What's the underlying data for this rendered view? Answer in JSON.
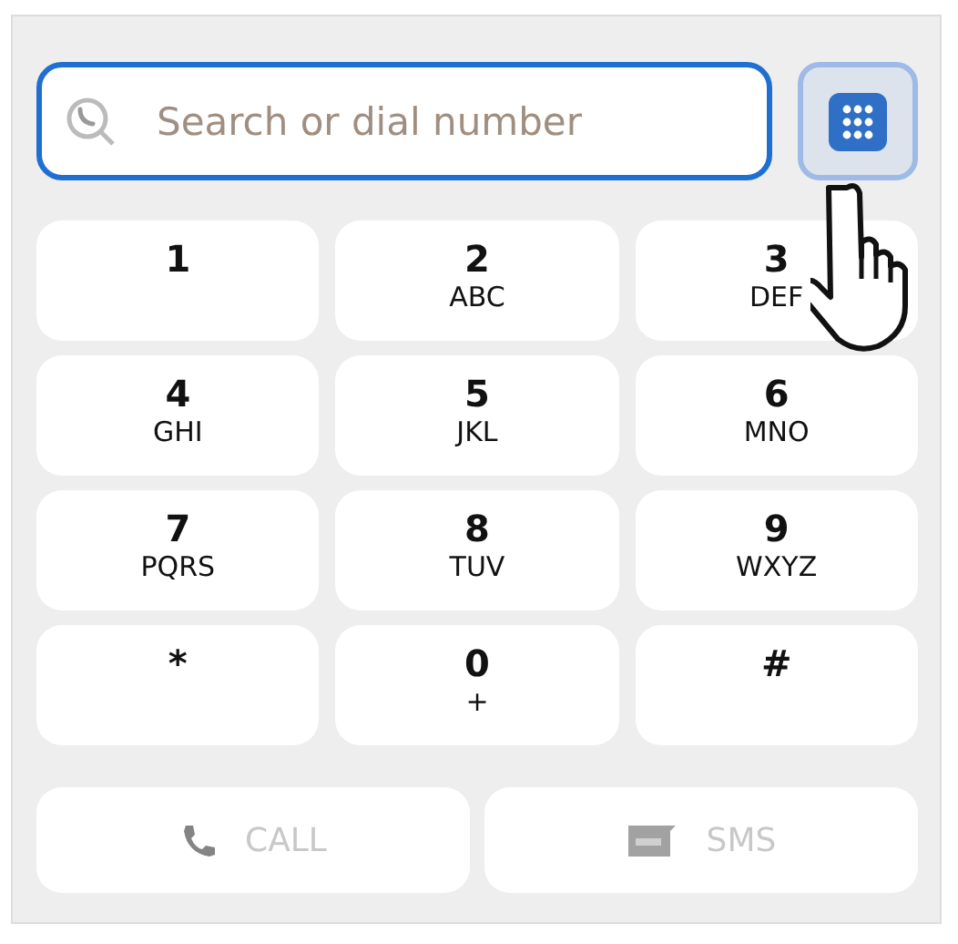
{
  "search": {
    "placeholder": "Search or dial number",
    "focused": true
  },
  "keypad_toggle": {
    "selected": true
  },
  "keys": [
    {
      "digit": "1"
    },
    {
      "digit": "2",
      "letters": "ABC"
    },
    {
      "digit": "3",
      "letters": "DEF"
    },
    {
      "digit": "4",
      "letters": "GHI"
    },
    {
      "digit": "5",
      "letters": "JKL"
    },
    {
      "digit": "6",
      "letters": "MNO"
    },
    {
      "digit": "7",
      "letters": "PQRS"
    },
    {
      "digit": "8",
      "letters": "TUV"
    },
    {
      "digit": "9",
      "letters": "WXYZ"
    },
    {
      "digit": "*"
    },
    {
      "digit": "0",
      "letters": "+"
    },
    {
      "digit": "#"
    }
  ],
  "actions": [
    {
      "kind": "call",
      "label": "CALL",
      "disabled": true
    },
    {
      "kind": "sms",
      "label": "SMS",
      "disabled": true
    }
  ]
}
